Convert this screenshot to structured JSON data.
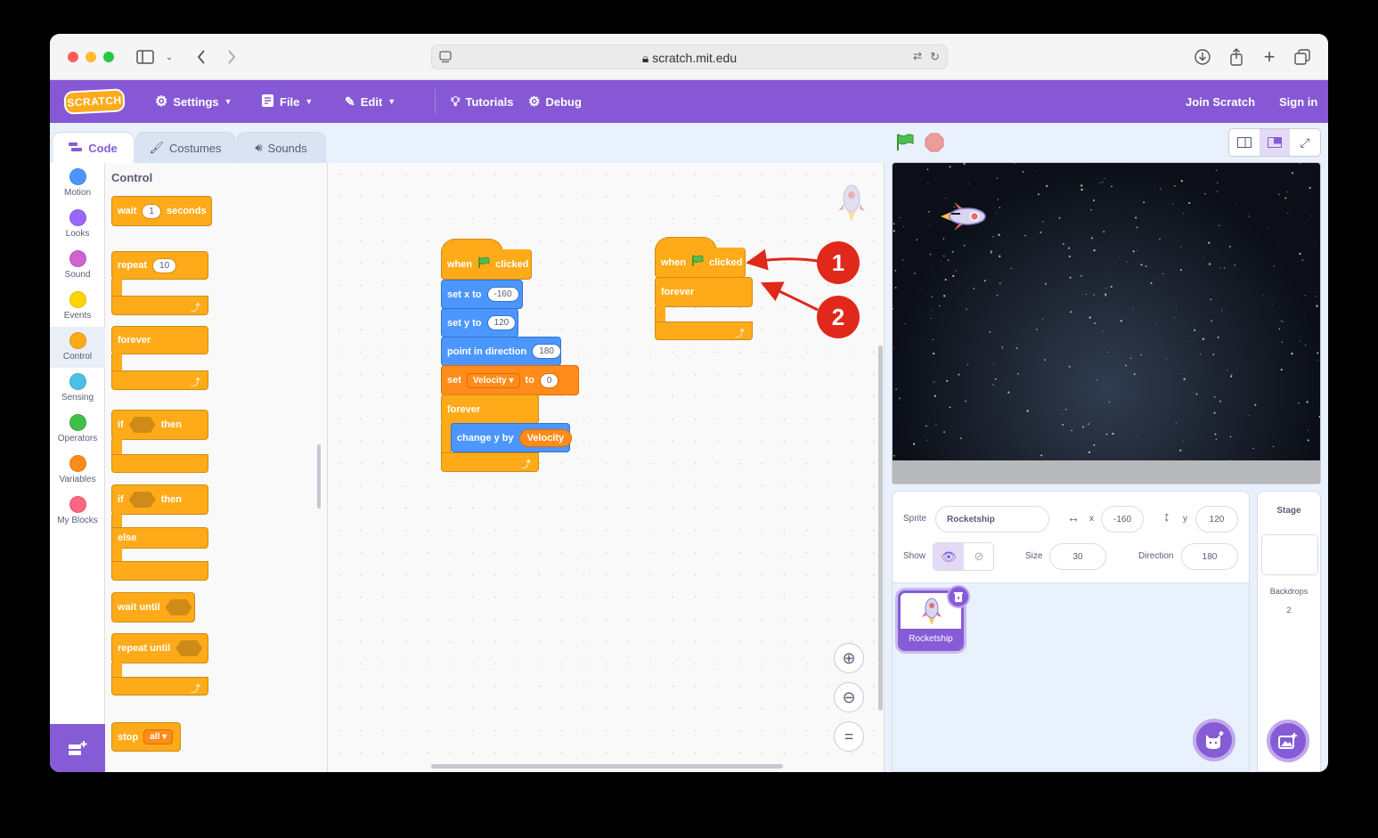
{
  "browser": {
    "url": "scratch.mit.edu"
  },
  "menubar": {
    "logo": "SCRATCH",
    "settings": "Settings",
    "file": "File",
    "edit": "Edit",
    "tutorials": "Tutorials",
    "debug": "Debug",
    "join": "Join Scratch",
    "signin": "Sign in"
  },
  "tabs": {
    "code": "Code",
    "costumes": "Costumes",
    "sounds": "Sounds"
  },
  "categories": [
    {
      "label": "Motion",
      "color": "#4c97ff"
    },
    {
      "label": "Looks",
      "color": "#9966ff"
    },
    {
      "label": "Sound",
      "color": "#cf63cf"
    },
    {
      "label": "Events",
      "color": "#ffd500"
    },
    {
      "label": "Control",
      "color": "#ffab19"
    },
    {
      "label": "Sensing",
      "color": "#4cbfe6"
    },
    {
      "label": "Operators",
      "color": "#40bf4a"
    },
    {
      "label": "Variables",
      "color": "#ff8c1a"
    },
    {
      "label": "My Blocks",
      "color": "#ff6680"
    }
  ],
  "palette": {
    "title": "Control",
    "wait": "wait",
    "wait_value": "1",
    "seconds": "seconds",
    "repeat": "repeat",
    "repeat_value": "10",
    "forever": "forever",
    "if": "if",
    "then": "then",
    "else": "else",
    "wait_until": "wait until",
    "repeat_until": "repeat until",
    "stop": "stop",
    "stop_value": "all"
  },
  "script1": {
    "when": "when",
    "clicked": "clicked",
    "set_x": "set x to",
    "x_value": "-160",
    "set_y": "set y to",
    "y_value": "120",
    "point": "point in direction",
    "direction_value": "180",
    "set": "set",
    "variable": "Velocity",
    "to": "to",
    "set_value": "0",
    "forever": "forever",
    "change_y": "change y by",
    "change_value": "Velocity"
  },
  "script2": {
    "when": "when",
    "clicked": "clicked",
    "forever": "forever"
  },
  "annotations": {
    "one": "1",
    "two": "2"
  },
  "sprite_info": {
    "sprite_label": "Sprite",
    "sprite_name": "Rocketship",
    "x_label": "x",
    "x_value": "-160",
    "y_label": "y",
    "y_value": "120",
    "show_label": "Show",
    "size_label": "Size",
    "size_value": "30",
    "direction_label": "Direction",
    "direction_value": "180"
  },
  "sprite_tile": {
    "name": "Rocketship"
  },
  "stage_panel": {
    "title": "Stage",
    "backdrops_label": "Backdrops",
    "backdrops_count": "2"
  },
  "colors": {
    "brand": "#855cd6",
    "control": "#ffab19",
    "motion": "#4c97ff",
    "variables": "#ff8c1a",
    "annotation": "#e0281b"
  }
}
